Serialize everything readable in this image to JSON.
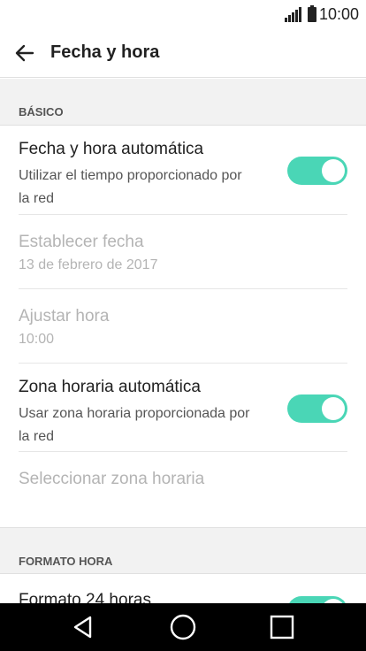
{
  "status_bar": {
    "time": "10:00",
    "icons": [
      "signal-icon",
      "battery-icon"
    ]
  },
  "app_bar": {
    "title": "Fecha y hora",
    "back_icon": "arrow-back-icon"
  },
  "sections": {
    "basic": {
      "header": "BÁSICO"
    },
    "time_format": {
      "header": "FORMATO HORA"
    }
  },
  "items": {
    "auto_date_time": {
      "title": "Fecha y hora automática",
      "subtitle": "Utilizar el tiempo proporcionado por la red",
      "enabled": true
    },
    "set_date": {
      "title": "Establecer fecha",
      "value": "13 de febrero de 2017"
    },
    "set_time": {
      "title": "Ajustar hora",
      "value": "10:00"
    },
    "auto_timezone": {
      "title": "Zona horaria automática",
      "subtitle": "Usar zona horaria proporcionada por la red",
      "enabled": true
    },
    "select_timezone": {
      "title": "Seleccionar zona horaria"
    },
    "format_24h": {
      "title": "Formato 24 horas",
      "enabled": true
    }
  },
  "colors": {
    "accent": "#4ad6b6",
    "disabled_text": "#b4b4b4",
    "section_bg": "#f2f2f2"
  },
  "nav_bar": {
    "buttons": [
      "back-triangle-icon",
      "home-circle-icon",
      "recents-square-icon"
    ]
  }
}
